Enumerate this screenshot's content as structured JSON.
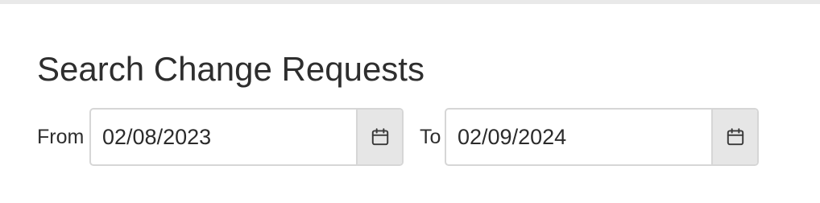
{
  "page": {
    "title": "Search Change Requests"
  },
  "filters": {
    "from": {
      "label": "From",
      "value": "02/08/2023",
      "calendar_icon": "calendar-icon"
    },
    "to": {
      "label": "To",
      "value": "02/09/2024",
      "calendar_icon": "calendar-icon"
    }
  },
  "colors": {
    "text": "#2e2e2e",
    "border": "#d6d6d6",
    "addon_background": "#e6e6e6",
    "top_bar": "#e9e9e9"
  }
}
